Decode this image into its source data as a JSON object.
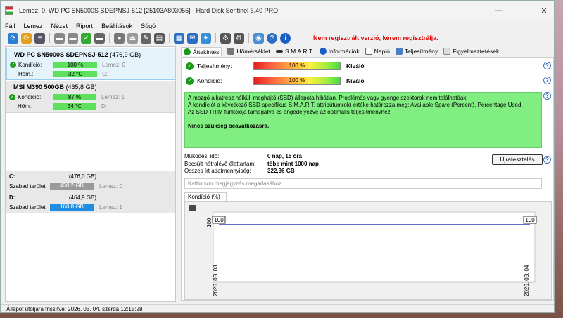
{
  "window": {
    "title": "Lemez: 0, WD PC SN5000S SDEPNSJ-512 [25103A803056]  -  Hard Disk Sentinel 6.40 PRO",
    "minimize": "—",
    "maximize": "☐",
    "close": "✕"
  },
  "menu": [
    "Fájl",
    "Lemez",
    "Nézet",
    "Riport",
    "Beállítások",
    "Súgó"
  ],
  "toolbar": {
    "promo": "Nem regisztrált verzió, kérem regisztrálja."
  },
  "disks": [
    {
      "name": "WD PC SN5000S SDEPNSJ-512",
      "size": "(476,9 GB)",
      "condition_label": "Kondíció:",
      "condition": "100 %",
      "condition_pct": 100,
      "condition_side": "Lemez: 0",
      "temp_label": "Hőm.:",
      "temp": "32 °C",
      "temp_side": "C:"
    },
    {
      "name": "MSI M390 500GB",
      "size": "(465,8 GB)",
      "condition_label": "Kondíció:",
      "condition": "87 %",
      "condition_pct": 87,
      "condition_side": "Lemez: 1",
      "temp_label": "Hőm.:",
      "temp": "34 °C",
      "temp_side": "D:"
    }
  ],
  "drives": [
    {
      "name": "C:",
      "size": "(476,0 GB)",
      "free_label": "Szabad terület",
      "free": "430,2 GB",
      "side": "Lemez: 0",
      "color": "#9a9a9a"
    },
    {
      "name": "D:",
      "size": "(464,9 GB)",
      "free_label": "Szabad terület",
      "free": "160,8 GB",
      "side": "Lemez: 1",
      "color": "#1f8ee0"
    }
  ],
  "tabs": [
    "Áttekintés",
    "Hőmérséklet",
    "S.M.A.R.T.",
    "Információk",
    "Napló",
    "Teljesítmény",
    "Figyelmeztetések"
  ],
  "overview": {
    "perf_label": "Teljesítmény:",
    "perf_value": "100 %",
    "perf_status": "Kiváló",
    "cond_label": "Kondíció:",
    "cond_value": "100 %",
    "cond_status": "Kiváló",
    "info_lines": [
      "A mozgó alkatrész nélküli meghajtó (SSD) állapota hibátlan. Problémás vagy gyenge szektorok nem találhatóak.",
      "A kondíciót a következő SSD-specifikus S.M.A.R.T. attribútum(ok) értéke határozza meg:  Available Spare (Percent), Percentage Used",
      "Az SSD TRIM funkciója támogatva és engedélyezve az optimális teljesítményhez."
    ],
    "info_action": "Nincs szükség beavatkozásra.",
    "uptime_label": "Működési idő:",
    "uptime": "0 nap, 16 óra",
    "life_label": "Becsült hátralévő élettartam:",
    "life": "több mint 1000 nap",
    "written_label": "Összes írt adatmennyiség:",
    "written": "322,36 GB",
    "retest": "Újratesztelés",
    "note_placeholder": "Kattintson megjegyzés megadásához ...",
    "chart_tab": "Kondíció  (%)"
  },
  "chart_data": {
    "type": "line",
    "x": [
      "2026. 03. 03",
      "2026. 03. 04"
    ],
    "series": [
      {
        "values": [
          100,
          100
        ]
      }
    ],
    "ylim": [
      0,
      100
    ],
    "ytick": "100",
    "color": "#2a3fbf"
  },
  "status": "Állapot utoljára frissítve: 2026. 03. 04. szerda 12:15:28"
}
